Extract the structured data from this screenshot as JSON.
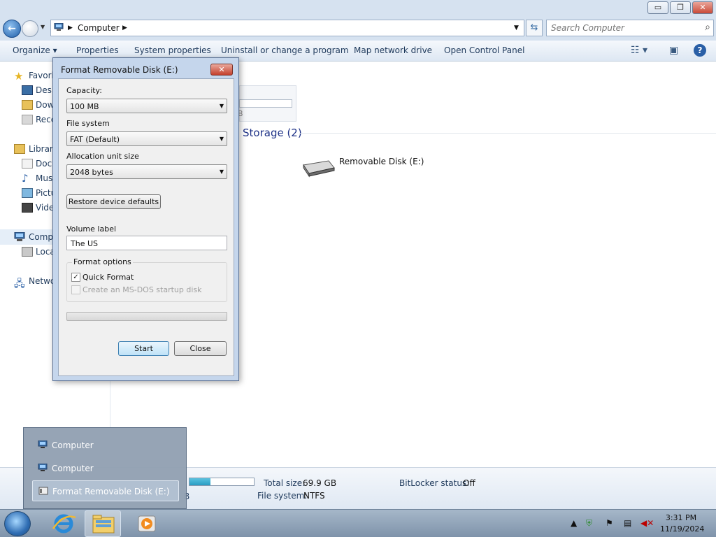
{
  "window": {
    "controls": {
      "minimize": "▭",
      "maximize": "❐",
      "close": "✕"
    }
  },
  "navigation": {
    "breadcrumb": "Computer",
    "search_placeholder": "Search Computer"
  },
  "toolbar": {
    "items": [
      "Organize",
      "Properties",
      "System properties",
      "Uninstall or change a program",
      "Map network drive",
      "Open Control Panel"
    ],
    "help": "?"
  },
  "nav_pane": {
    "favorites": "Favorit",
    "items": [
      "Desk",
      "Dow",
      "Rece"
    ],
    "libraries": "Librari",
    "library_items": [
      "Docu",
      "Mus",
      "Pictu",
      "Vide"
    ],
    "computer": "Comp",
    "computer_items": [
      "Loca"
    ],
    "network": "Netwo"
  },
  "content": {
    "ghost_text": "B",
    "section_title": "Storage (2)",
    "drive_label": "Removable Disk (E:)"
  },
  "details": {
    "used_fraction": 0.33,
    "partial_text": "B",
    "total_size_label": "Total size:",
    "total_size_value": "69.9 GB",
    "file_system_label": "File system:",
    "file_system_value": "NTFS",
    "bitlocker_label": "BitLocker status:",
    "bitlocker_value": "Off"
  },
  "dialog": {
    "title": "Format Removable Disk (E:)",
    "close": "✕",
    "capacity_label": "Capacity:",
    "capacity_value": "100 MB",
    "filesystem_label": "File system",
    "filesystem_value": "FAT (Default)",
    "allocation_label": "Allocation unit size",
    "allocation_value": "2048 bytes",
    "restore_button": "Restore device defaults",
    "volume_label": "Volume label",
    "volume_value": "The US",
    "format_options_label": "Format options",
    "quick_format_label": "Quick Format",
    "quick_format_checked": true,
    "msdos_label": "Create an MS-DOS startup disk",
    "msdos_checked": false,
    "progress": 0,
    "start_button": "Start",
    "close_button": "Close"
  },
  "taskbar_popup": {
    "items": [
      "Computer",
      "Computer",
      "Format Removable Disk (E:)"
    ],
    "active_index": 2
  },
  "taskbar": {
    "time": "3:31 PM",
    "date": "11/19/2024",
    "tray_icons": [
      "chevron-up-icon",
      "security-shield-icon",
      "flag-icon",
      "network-icon",
      "volume-muted-icon"
    ]
  }
}
